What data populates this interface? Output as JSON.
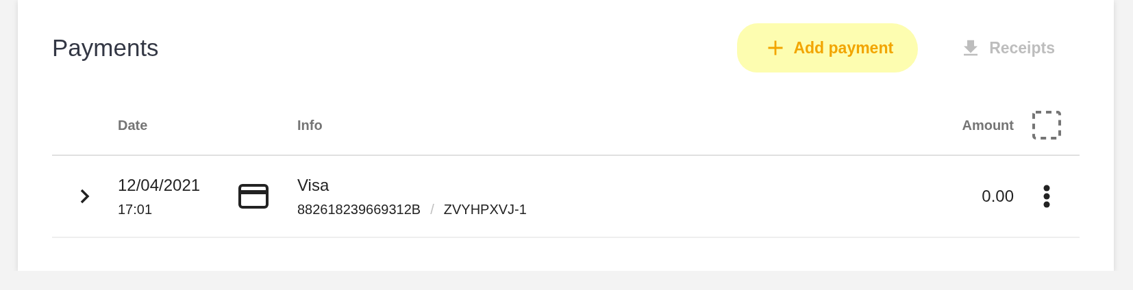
{
  "title": "Payments",
  "actions": [
    {
      "kind": "add",
      "label": "Add payment",
      "disabled": false,
      "highlighted": true
    },
    {
      "kind": "download",
      "label": "Receipts",
      "disabled": true,
      "highlighted": false
    }
  ],
  "table": {
    "columns": [
      "Date",
      "Info",
      "Amount"
    ],
    "rows": [
      {
        "expanded": false,
        "date": "12/04/2021",
        "time": "17:01",
        "name": "Visa",
        "reference": "882618239669312B",
        "separator": "/",
        "code": "ZVYHPXVJ-1",
        "amount": "0.00"
      }
    ]
  }
}
